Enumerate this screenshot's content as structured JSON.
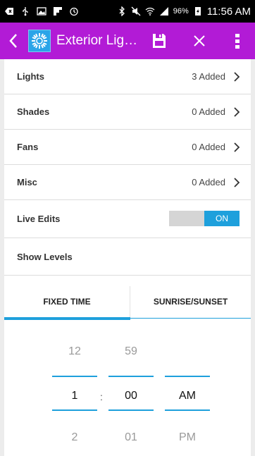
{
  "status_bar": {
    "battery": "96%",
    "time": "11:56 AM"
  },
  "app_bar": {
    "title": "Exterior Lig…"
  },
  "rows": [
    {
      "label": "Lights",
      "value": "3 Added"
    },
    {
      "label": "Shades",
      "value": "0 Added"
    },
    {
      "label": "Fans",
      "value": "0 Added"
    },
    {
      "label": "Misc",
      "value": "0 Added"
    }
  ],
  "live_edits": {
    "label": "Live Edits",
    "toggle_label": "ON"
  },
  "show_levels": {
    "label": "Show Levels"
  },
  "tabs": {
    "fixed_time": "FIXED TIME",
    "sunrise_sunset": "SUNRISE/SUNSET"
  },
  "time_picker": {
    "hours": {
      "prev": "12",
      "selected": "1",
      "next": "2"
    },
    "minutes": {
      "prev": "59",
      "selected": "00",
      "next": "01"
    },
    "ampm": {
      "selected": "AM",
      "next": "PM"
    },
    "separator": ":"
  },
  "colors": {
    "app_bar": "#b21bd6",
    "accent": "#1ea0dc"
  }
}
